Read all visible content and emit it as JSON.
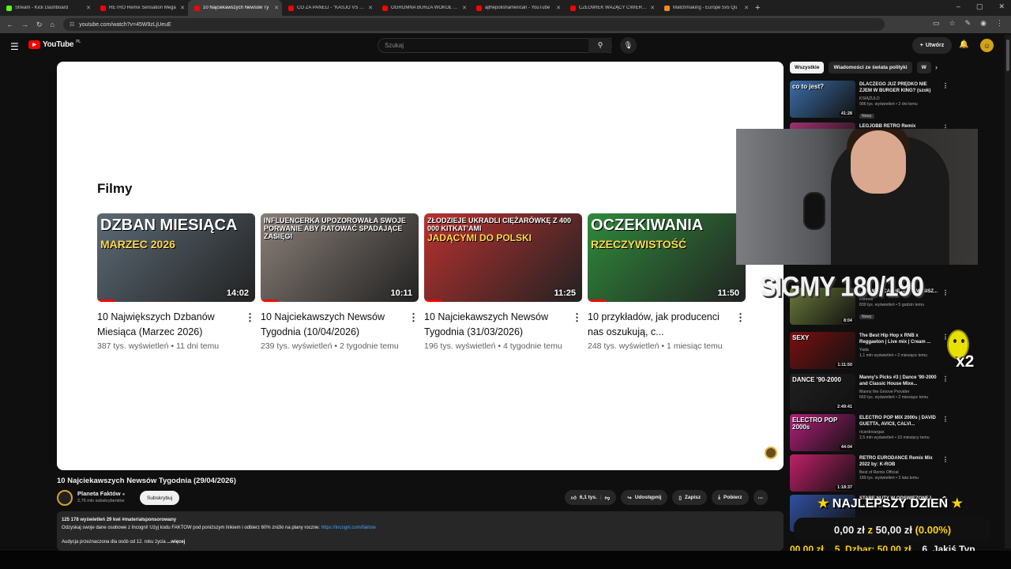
{
  "browser": {
    "tabs": [
      {
        "title": "Stream - Kick Dashboard",
        "color": "#53fc18",
        "active": false
      },
      {
        "title": "RETRO Remix Sensation Mega",
        "color": "#ff0000",
        "active": false
      },
      {
        "title": "10 Najciekawszych Newsów Ty",
        "color": "#ff0000",
        "active": true
      },
      {
        "title": "CO ZA PANELI - \"KASJO VS BO",
        "color": "#ff0000",
        "active": false
      },
      {
        "title": "OGROMNA BURZA WOKÓŁ NA",
        "color": "#ff0000",
        "active": false
      },
      {
        "title": "ajthepolishamerican - YouTube",
        "color": "#ff0000",
        "active": false
      },
      {
        "title": "CZŁOWIEK WAŻĄCY ĆWIERĆ T",
        "color": "#ff0000",
        "active": false
      },
      {
        "title": "Matchmaking - Europe 5v5 Qu",
        "color": "#f08a24",
        "active": false
      }
    ],
    "new_tab": "+",
    "url": "youtube.com/watch?v=45W9zLjUeuE"
  },
  "youtube": {
    "logo_text": "YouTube",
    "region": "PL",
    "search_placeholder": "Szukaj",
    "create_label": "Utwórz"
  },
  "player": {
    "heading": "Filmy",
    "cards": [
      {
        "thumb_text": "DZBAN MIESIĄCA",
        "thumb_sub": "MARZEC 2026",
        "duration": "14:02",
        "title": "10 Największych Dzbanów Miesiąca (Marzec 2026)",
        "info": "387 tys. wyświetleń • 11 dni temu",
        "bg": "#5c6a75"
      },
      {
        "thumb_text": "INFLUENCERKA UPOZOROWAŁA SWOJE PORWANIE ABY RATOWAĆ SPADAJĄCE ZASIĘGI",
        "thumb_sub": "",
        "duration": "10:11",
        "title": "10 Najciekawszych Newsów Tygodnia (10/04/2026)",
        "info": "239 tys. wyświetleń • 2 tygodnie temu",
        "bg": "#8a7f78"
      },
      {
        "thumb_text": "ZŁODZIEJE UKRADLI CIĘŻARÓWKĘ Z 400 000 KITKAT'AMI",
        "thumb_sub": "JADĄCYMI DO POLSKI",
        "duration": "11:25",
        "title": "10 Najciekawszych Newsów Tygodnia (31/03/2026)",
        "info": "196 tys. wyświetleń • 4 tygodnie temu",
        "bg": "#b8312f"
      },
      {
        "thumb_text": "OCZEKIWANIA",
        "thumb_sub": "RZECZYWISTOŚĆ",
        "duration": "11:50",
        "title": "10 przykładów, jak producenci nas oszukują, c...",
        "info": "248 tys. wyświetleń • 1 miesiąc temu",
        "bg": "#2f8a3a"
      }
    ]
  },
  "video": {
    "title": "10 Najciekawszych Newsów Tygodnia (29/04/2026)",
    "channel": "Planeta Faktów",
    "subscribers": "2,76 mln subskrybentów",
    "subscribe_label": "Subskrybuj",
    "likes": "6,1 tys.",
    "share_label": "Udostępnij",
    "save_label": "Zapisz",
    "download_label": "Pobierz",
    "desc_stats": "125 178 wyświetleń  29 kwi  #materiałsponsorowany",
    "desc_line": "Odzyskaj swoje dane osobowe z Incogni! Użyj kodu FAKTOW pod poniższym linkiem i odbierz 60% zniżki na plany roczne: ",
    "desc_link": "https://incogni.com/faktow",
    "desc_line2": "Audycja przeznaczona dla osób od 12. roku życia",
    "desc_more": "...więcej"
  },
  "sidebar": {
    "chips": [
      "Wszystkie",
      "Wiadomości ze świata polityki",
      "W"
    ],
    "recommendations": [
      {
        "title": "DLACZEGO JUŻ PRĘDKO NIE ZJEM W BURGER KING? (szok)",
        "channel": "KSIĄŻULO",
        "views": "996 tys. wyświetleń • 2 dni temu",
        "badge": "Nowy",
        "duration": "41:28",
        "thumb_text": "co to jest?",
        "bg": "#3b6ea8"
      },
      {
        "title": "LEGJOBB RETRO Remix",
        "channel": "",
        "views": "",
        "badge": "",
        "duration": "",
        "thumb_text": "",
        "bg": "#a03070"
      },
      {
        "title": "...NOWYM CACHE, które MUSISZ...",
        "channel": "Forever",
        "views": "830 tys. wyświetleń • 5 godzin temu",
        "badge": "Nowy",
        "duration": "8:04",
        "thumb_text": "",
        "bg": "#6a7a3a"
      },
      {
        "title": "The Best  Hip Hop x RNB x Reggaeton | Live mix | Cream ...",
        "channel": "Yada",
        "views": "1,1 mln wyświetleń • 2 miesiące temu",
        "badge": "",
        "duration": "1:11:50",
        "thumb_text": "SEXY",
        "bg": "#7a1010"
      },
      {
        "title": "Manny's Picks #3 | Dance '90-2000 and Classic House Mixe...",
        "channel": "Manny the Groove Provider",
        "views": "660 tys. wyświetleń • 2 miesiące temu",
        "badge": "",
        "duration": "2:49:41",
        "thumb_text": "DANCE '90-2000",
        "bg": "#202020"
      },
      {
        "title": "ELECTRO POP MIX 2000s | DAVID GUETTA, AVICII, CALVI...",
        "channel": "ricardovargas",
        "views": "2,5 mln wyświetleń • 10 miesięcy temu",
        "badge": "",
        "duration": "44:04",
        "thumb_text": "ELECTRO POP 2000s",
        "bg": "#b0207a"
      },
      {
        "title": "RETRO EURODANCE Remix Mix 2022 by: K-ROB",
        "channel": "Best of Remix Official",
        "views": "189 tys. wyświetleń • 3 lata temu",
        "badge": "",
        "duration": "1:18:37",
        "thumb_text": "",
        "bg": "#c0206a"
      },
      {
        "title": "STARE NUTY W ODŚWIEŻONEJ ...",
        "channel": "DJ Tomek Edm",
        "views": "",
        "badge": "",
        "duration": "",
        "thumb_text": "",
        "bg": "#3050a0"
      }
    ]
  },
  "overlay": {
    "sigmy": "SIGMY 180/190",
    "multiplier": "x2",
    "banner_star": "★",
    "banner": "NAJLEPSZY DZIEŃ",
    "goal_current": "0,00 zł",
    "goal_sep": "z",
    "goal_target": "50,00 zł",
    "goal_percent": "(0.00%)",
    "ticker": [
      "00,00 zł",
      "5. Dzbar: 50,00 zł",
      "6. Jakiś Typ"
    ]
  }
}
